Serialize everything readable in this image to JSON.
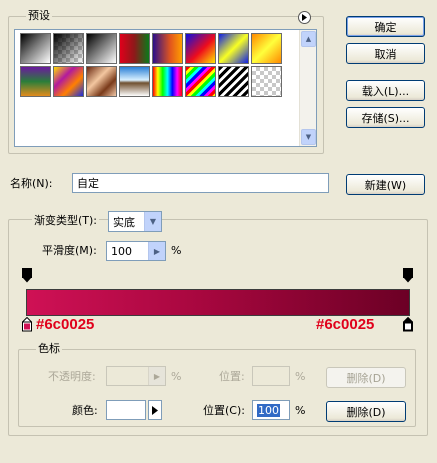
{
  "presets": {
    "legend": "预设",
    "menu_icon": "right-arrow-circle-icon"
  },
  "buttons": {
    "ok": "确定",
    "cancel": "取消",
    "load": "载入(L)...",
    "save": "存储(S)...",
    "new": "新建(W)",
    "delete_opacity": "删除(D)",
    "delete_color": "删除(D)"
  },
  "name_field": {
    "label": "名称(N):",
    "value": "自定"
  },
  "gradient_type": {
    "label": "渐变类型(T):",
    "value": "实底"
  },
  "smoothness": {
    "label": "平滑度(M):",
    "value": "100",
    "unit": "%"
  },
  "gradient": {
    "left_color_label": "#6c0025",
    "right_color_label": "#6c0025",
    "start_color": "#cf1155",
    "end_color": "#6c0025"
  },
  "color_stops": {
    "legend": "色标",
    "opacity_label": "不透明度:",
    "opacity_unit": "%",
    "opacity_location_label": "位置:",
    "opacity_location_unit": "%",
    "color_label": "颜色:",
    "color_location_label": "位置(C):",
    "color_location_value": "100",
    "color_location_unit": "%"
  }
}
